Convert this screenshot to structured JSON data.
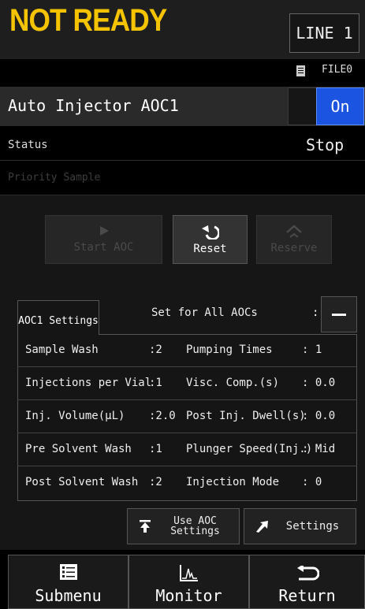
{
  "header": {
    "title": "NOT READY",
    "line_label": "LINE 1"
  },
  "file": {
    "icon": "file-icon",
    "label": "FILE0"
  },
  "injector": {
    "name": "Auto Injector AOC1",
    "toggle_label": "On"
  },
  "status": {
    "label": "Status",
    "value": "Stop"
  },
  "priority": {
    "label": "Priority Sample"
  },
  "actions": {
    "start": {
      "label": "Start AOC",
      "icon": "play-icon"
    },
    "reset": {
      "label": "Reset",
      "icon": "reset-icon"
    },
    "reserve": {
      "label": "Reserve",
      "icon": "reserve-icon"
    }
  },
  "aoc_settings": {
    "tab_label": "AOC1 Settings",
    "set_all_label": "Set for All AOCs",
    "set_all_colon": ":",
    "rows": [
      {
        "left_label": "Sample Wash",
        "left_value": ":2",
        "right_label": "Pumping Times",
        "right_value": ": 1"
      },
      {
        "left_label": "Injections per Vial",
        "left_value": ":1",
        "right_label": "Visc. Comp.(s)",
        "right_value": ": 0.0"
      },
      {
        "left_label": "Inj. Volume(µL)",
        "left_value": ":2.0",
        "right_label": "Post Inj. Dwell(s)",
        "right_value": ": 0.0"
      },
      {
        "left_label": "Pre Solvent Wash",
        "left_value": ":1",
        "right_label": "Plunger Speed(Inj.)",
        "right_value": ": Mid"
      },
      {
        "left_label": "Post Solvent Wash",
        "left_value": ":2",
        "right_label": "Injection Mode",
        "right_value": ": 0"
      }
    ]
  },
  "bottom_buttons": {
    "use_aoc_line1": "Use AOC",
    "use_aoc_line2": "Settings",
    "settings": "Settings"
  },
  "nav": {
    "submenu": "Submenu",
    "monitor": "Monitor",
    "return": "Return"
  },
  "colors": {
    "title": "#f5c400",
    "toggle_on": "#1b54e0"
  }
}
